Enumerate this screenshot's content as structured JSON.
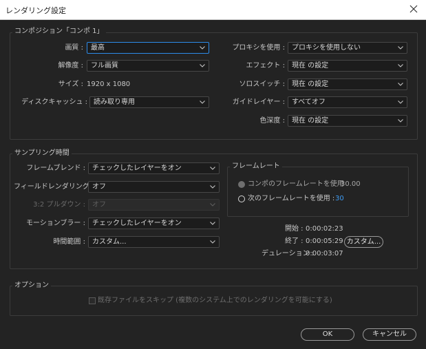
{
  "window": {
    "title": "レンダリング設定"
  },
  "composition": {
    "group_label": "コンポジション「コンポ 1」",
    "quality": {
      "label": "画質 :",
      "value": "最高"
    },
    "resolution": {
      "label": "解像度 :",
      "value": "フル画質"
    },
    "size": {
      "label": "サイズ :",
      "value": "1920 x 1080"
    },
    "disk_cache": {
      "label": "ディスクキャッシュ :",
      "value": "読み取り専用"
    },
    "proxy": {
      "label": "プロキシを使用 :",
      "value": "プロキシを使用しない"
    },
    "effects": {
      "label": "エフェクト :",
      "value": "現在 の設定"
    },
    "solo": {
      "label": "ソロスイッチ :",
      "value": "現在 の設定"
    },
    "guide": {
      "label": "ガイドレイヤー :",
      "value": "すべてオフ"
    },
    "depth": {
      "label": "色深度 :",
      "value": "現在 の設定"
    }
  },
  "sampling": {
    "group_label": "サンプリング時間",
    "frame_blend": {
      "label": "フレームブレンド :",
      "value": "チェックしたレイヤーをオン"
    },
    "field_render": {
      "label": "フィールドレンダリング :",
      "value": "オフ"
    },
    "pulldown": {
      "label": "3:2 プルダウン :",
      "value": "オフ"
    },
    "motion_blur": {
      "label": "モーションブラー :",
      "value": "チェックしたレイヤーをオン"
    },
    "time_span": {
      "label": "時間範囲 :",
      "value": "カスタム..."
    },
    "framerate": {
      "group_label": "フレームレート",
      "comp_rate_label": "コンポのフレームレートを使用",
      "comp_rate_value": "30.00",
      "next_rate_label": "次のフレームレートを使用 :",
      "next_rate_value": "30"
    },
    "start": {
      "label": "開始 :",
      "value": "0:00:02:23"
    },
    "end": {
      "label": "終了 :",
      "value": "0:00:05:29"
    },
    "duration": {
      "label": "デュレーション :",
      "value": "0:00:03:07"
    },
    "custom_button": "カスタム..."
  },
  "options": {
    "group_label": "オプション",
    "skip_existing": "既存ファイルをスキップ (複数のシステム上でのレンダリングを可能にする)"
  },
  "buttons": {
    "ok": "OK",
    "cancel": "キャンセル"
  },
  "colors": {
    "background": "#232323",
    "accent": "#2d8ceb",
    "value_blue": "#3d9bf3"
  }
}
